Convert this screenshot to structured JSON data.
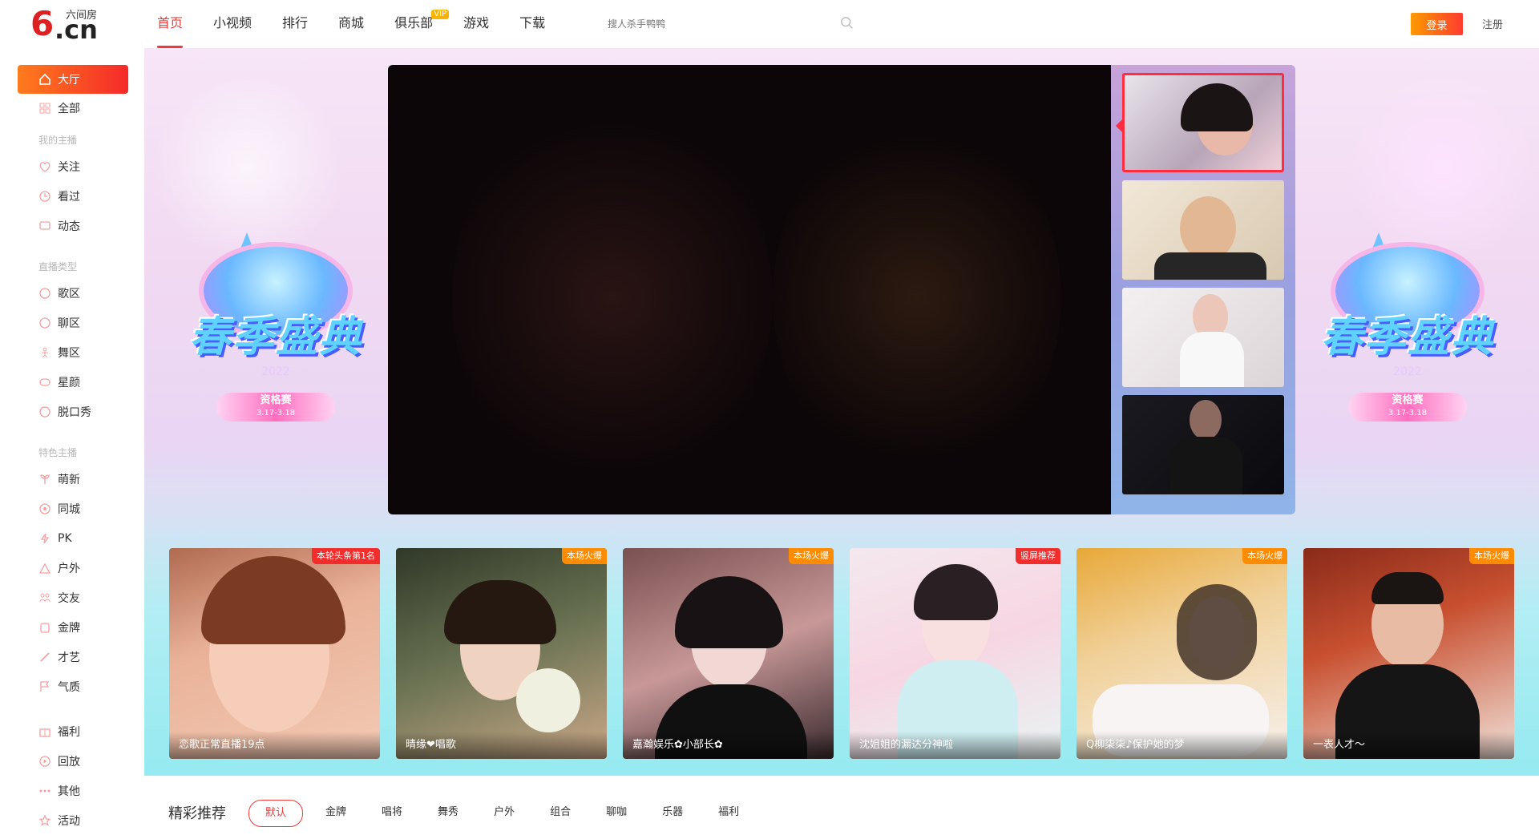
{
  "logo": {
    "six": "6",
    "cn": ".cn",
    "top": "六间房"
  },
  "nav": {
    "items": [
      {
        "label": "首页"
      },
      {
        "label": "小视频"
      },
      {
        "label": "排行"
      },
      {
        "label": "商城"
      },
      {
        "label": "俱乐部",
        "badge": "VIP"
      },
      {
        "label": "游戏"
      },
      {
        "label": "下载"
      }
    ]
  },
  "search": {
    "placeholder": "搜人杀手鸭鸭"
  },
  "auth": {
    "login": "登录",
    "register": "注册"
  },
  "sidebar": {
    "hall": "大厅",
    "all": "全部",
    "sec_my": "我的主播",
    "follow": "关注",
    "watched": "看过",
    "feed": "动态",
    "sec_type": "直播类型",
    "song": "歌区",
    "chat": "聊区",
    "dance": "舞区",
    "star": "星颜",
    "talk": "脱口秀",
    "sec_feature": "特色主播",
    "cute": "萌新",
    "city": "同城",
    "pk": "PK",
    "outdoor": "户外",
    "friends": "交友",
    "gold": "金牌",
    "talent": "才艺",
    "temper": "气质",
    "welfare": "福利",
    "replay": "回放",
    "other": "其他",
    "event": "活动"
  },
  "banner": {
    "title": "春季盛典",
    "year": "2022",
    "pill": "资格赛",
    "dates": "3.17-3.18"
  },
  "cards": [
    {
      "tag": "本轮头条第1名",
      "name": "恋歌正常直播19点"
    },
    {
      "tag": "本场火爆",
      "name": "晴缘❤唱歌"
    },
    {
      "tag": "本场火爆",
      "name": "嘉瀚娱乐✿小部长✿"
    },
    {
      "tag": "竖屏推荐",
      "name": "沈姐姐的漏达分神啦"
    },
    {
      "tag": "本场火爆",
      "name": "Q柳柒柒♪保护她的梦"
    },
    {
      "tag": "本场火爆",
      "name": "一表人才～"
    }
  ],
  "recommend": {
    "title": "精彩推荐",
    "tabs": [
      "默认",
      "金牌",
      "唱将",
      "舞秀",
      "户外",
      "组合",
      "聊咖",
      "乐器",
      "福利"
    ]
  },
  "colors": {
    "accent": "#f03a3a",
    "banner_top": "#f7e6f7",
    "banner_bottom": "#aeeef3"
  }
}
